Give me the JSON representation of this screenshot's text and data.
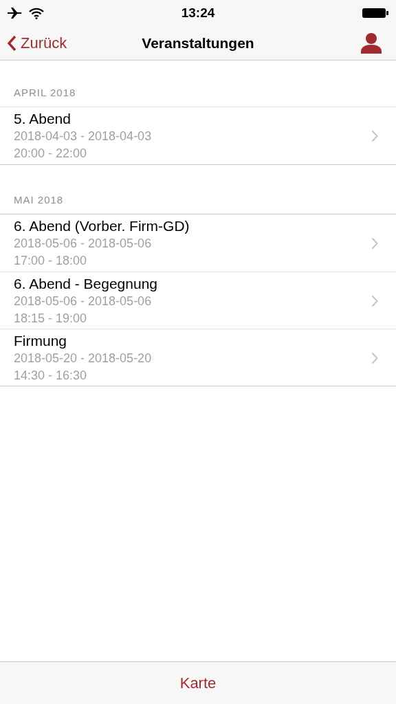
{
  "status_bar": {
    "time": "13:24"
  },
  "nav_bar": {
    "back": "Zurück",
    "title": "Veranstaltungen"
  },
  "sections": [
    {
      "header": "APRIL 2018",
      "rows": [
        {
          "title": "5. Abend",
          "dates": "2018-04-03 - 2018-04-03",
          "times": "20:00 - 22:00"
        }
      ]
    },
    {
      "header": "MAI 2018",
      "rows": [
        {
          "title": "6. Abend (Vorber. Firm-GD)",
          "dates": "2018-05-06 - 2018-05-06",
          "times": "17:00 - 18:00"
        },
        {
          "title": "6. Abend - Begegnung",
          "dates": "2018-05-06 - 2018-05-06",
          "times": "18:15 - 19:00"
        },
        {
          "title": "Firmung",
          "dates": "2018-05-20 - 2018-05-20",
          "times": "14:30 - 16:30"
        }
      ]
    }
  ],
  "toolbar": {
    "button": "Karte"
  }
}
